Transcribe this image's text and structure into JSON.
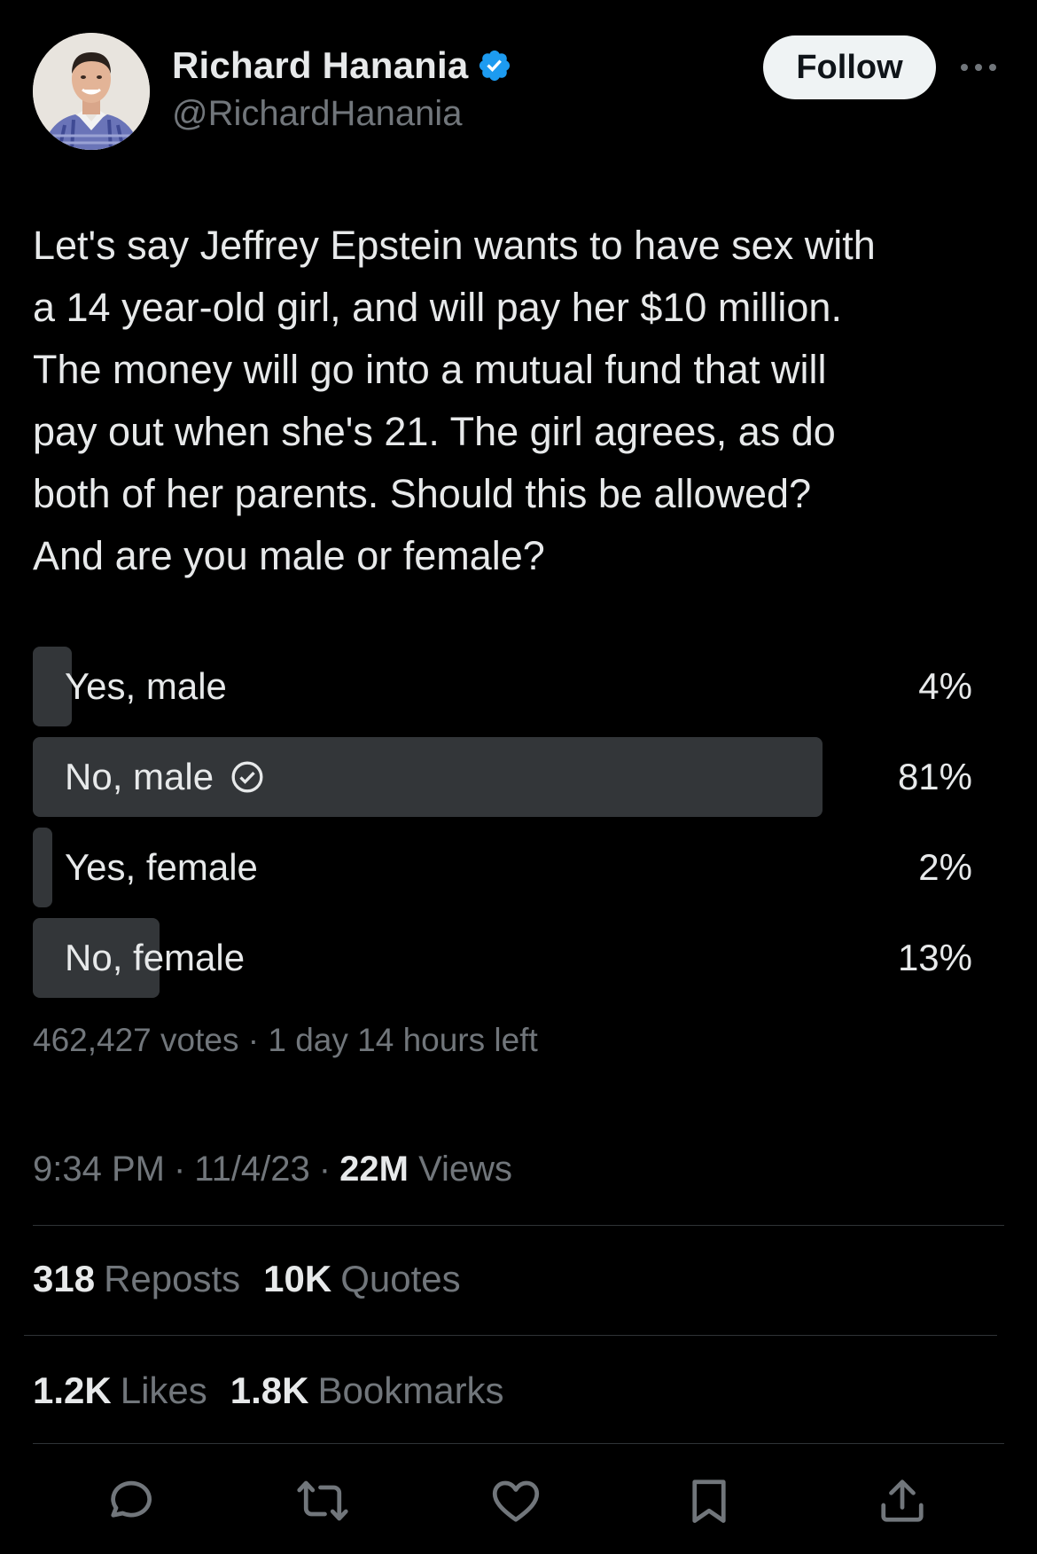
{
  "author": {
    "display_name": "Richard Hanania",
    "handle": "@RichardHanania",
    "verified_icon": "verified-badge-icon"
  },
  "header": {
    "follow_label": "Follow",
    "more_icon": "more-icon"
  },
  "tweet": {
    "lines": [
      "Let's say Jeffrey Epstein wants to have sex with",
      "a 14 year-old girl, and will pay her $10 million.",
      "The money will go into a mutual fund that will",
      "pay out when she's 21. The girl agrees, as do",
      "both of her parents. Should this be allowed?",
      "And are you male or female?"
    ]
  },
  "poll": {
    "options": [
      {
        "label": "Yes, male",
        "percent_label": "4%",
        "fraction": 0.04,
        "selected": false
      },
      {
        "label": "No, male",
        "percent_label": "81%",
        "fraction": 0.81,
        "selected": true
      },
      {
        "label": "Yes, female",
        "percent_label": "2%",
        "fraction": 0.02,
        "selected": false
      },
      {
        "label": "No, female",
        "percent_label": "13%",
        "fraction": 0.13,
        "selected": false
      }
    ],
    "meta": "462,427 votes · 1 day 14 hours left"
  },
  "timestamp": {
    "time": "9:34 PM",
    "sep1": "·",
    "date": "11/4/23",
    "sep2": "·",
    "views_count": "22M",
    "views_label": "Views"
  },
  "stats": {
    "reposts_count": "318",
    "reposts_label": "Reposts",
    "quotes_count": "10K",
    "quotes_label": "Quotes",
    "likes_count": "1.2K",
    "likes_label": "Likes",
    "bookmarks_count": "1.8K",
    "bookmarks_label": "Bookmarks"
  },
  "colors": {
    "background": "#000000",
    "text_primary": "#e7e9ea",
    "text_secondary": "#71767b",
    "poll_bar": "#333639",
    "divider": "#2f3336",
    "verified_blue": "#1d9bf0"
  },
  "actions": [
    "reply-icon",
    "repost-icon",
    "like-icon",
    "bookmark-icon",
    "share-icon"
  ]
}
